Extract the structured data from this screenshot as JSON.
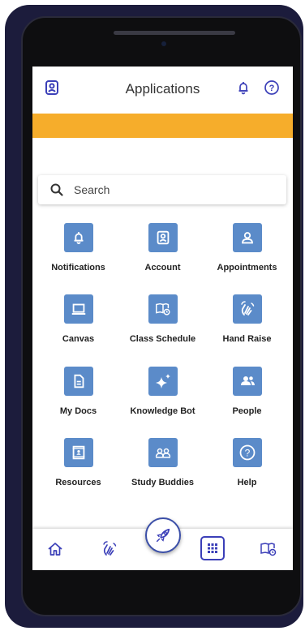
{
  "header": {
    "title": "Applications",
    "left_icon": "account-icon",
    "right_icons": [
      "bell-icon",
      "help-icon"
    ]
  },
  "banner": {
    "color": "#f6ad2b"
  },
  "search": {
    "placeholder": "Search"
  },
  "tiles": [
    {
      "label": "Notifications",
      "icon": "bell-icon"
    },
    {
      "label": "Account",
      "icon": "account-icon"
    },
    {
      "label": "Appointments",
      "icon": "person-icon"
    },
    {
      "label": "Canvas",
      "icon": "laptop-icon"
    },
    {
      "label": "Class Schedule",
      "icon": "book-clock-icon"
    },
    {
      "label": "Hand Raise",
      "icon": "hand-icon"
    },
    {
      "label": "My Docs",
      "icon": "document-icon"
    },
    {
      "label": "Knowledge Bot",
      "icon": "sparkle-icon"
    },
    {
      "label": "People",
      "icon": "people-icon"
    },
    {
      "label": "Resources",
      "icon": "contact-book-icon"
    },
    {
      "label": "Study Buddies",
      "icon": "study-buddies-icon"
    },
    {
      "label": "Help",
      "icon": "help-icon"
    }
  ],
  "bottom_nav": [
    "home-icon",
    "hand-icon",
    "rocket-icon",
    "apps-grid-icon",
    "book-clock-icon"
  ],
  "colors": {
    "tile": "#5b8bc9",
    "accent": "#3b3fb8",
    "banner": "#f6ad2b"
  }
}
